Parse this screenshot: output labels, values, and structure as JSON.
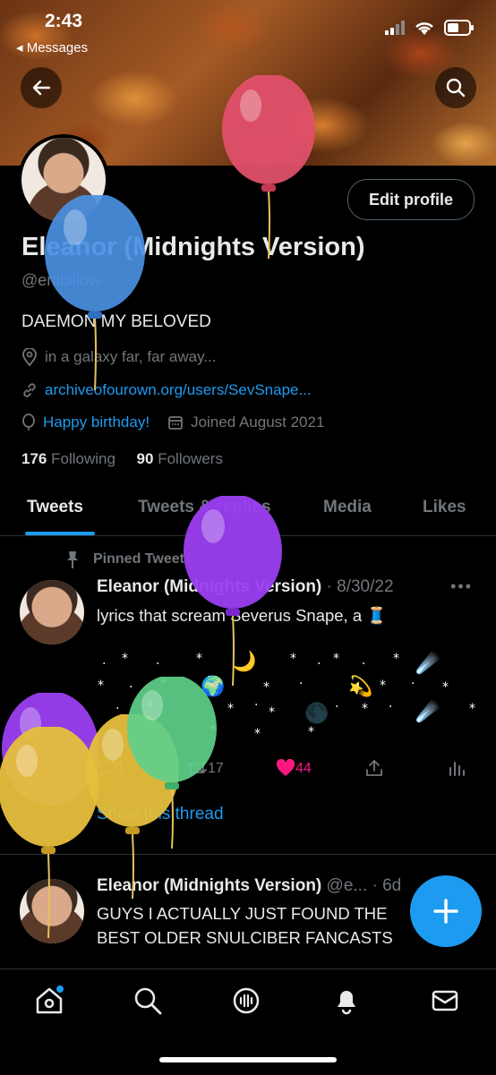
{
  "status": {
    "time": "2:43",
    "back_app": "Messages"
  },
  "profile": {
    "edit_label": "Edit profile",
    "name": "Eleanor (Midnights Version)",
    "handle": "@embillow",
    "bio": "DAEMON MY BELOVED",
    "location": "in a galaxy far, far away...",
    "website": "archiveofourown.org/users/SevSnape...",
    "birthday": "Happy birthday!",
    "joined": "Joined August 2021",
    "following_count": "176",
    "following_label": "Following",
    "followers_count": "90",
    "followers_label": "Followers"
  },
  "tabs": [
    {
      "label": "Tweets"
    },
    {
      "label": "Tweets & replies"
    },
    {
      "label": "Media"
    },
    {
      "label": "Likes"
    }
  ],
  "tweets": [
    {
      "pinned_label": "Pinned Tweet",
      "name": "Eleanor (Midnights Version)",
      "meta": "· 8/30/22",
      "text": "lyrics that scream Severus Snape, a 🧵",
      "replies": "1",
      "retweets": "17",
      "likes": "44",
      "show_thread": "Show this thread"
    },
    {
      "name": "Eleanor (Midnights Version)",
      "meta": "@e... · 6d",
      "text_line1": "GUYS I ACTUALLY JUST FOUND THE",
      "text_line2": "BEST OLDER SNULCIBER FANCASTS"
    }
  ],
  "colors": {
    "accent": "#1d9bf0",
    "like": "#f91880"
  }
}
